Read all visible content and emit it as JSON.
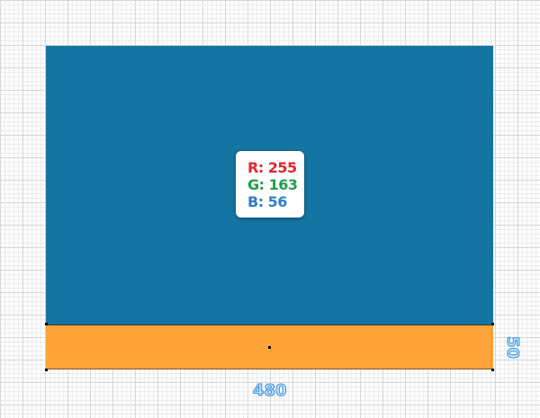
{
  "colors": {
    "blue": "#1475a3",
    "orange": "#ffa338"
  },
  "color_card": {
    "r": "R: 255",
    "g": "G: 163",
    "b": "B: 56"
  },
  "dimensions": {
    "width": "480",
    "height": "50"
  }
}
